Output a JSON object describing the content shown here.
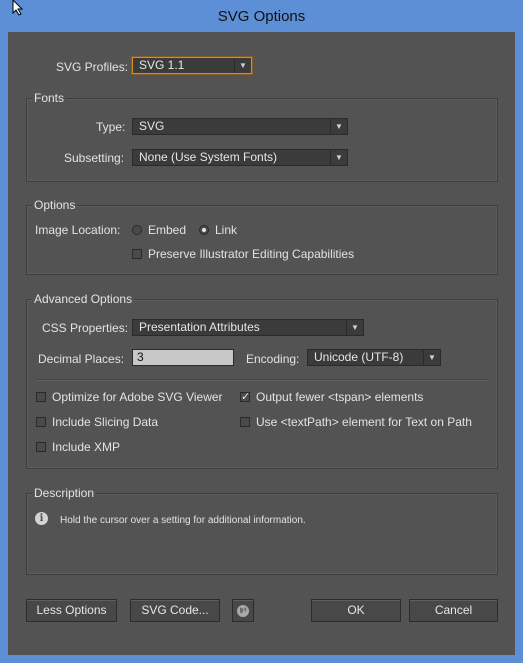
{
  "window": {
    "title": "SVG Options"
  },
  "profiles": {
    "label": "SVG Profiles:",
    "value": "SVG 1.1"
  },
  "fonts": {
    "title": "Fonts",
    "type_label": "Type:",
    "type_value": "SVG",
    "subsetting_label": "Subsetting:",
    "subsetting_value": "None (Use System Fonts)"
  },
  "options": {
    "title": "Options",
    "image_location_label": "Image Location:",
    "embed_label": "Embed",
    "link_label": "Link",
    "selected": "Link",
    "preserve_label": "Preserve Illustrator Editing Capabilities",
    "preserve_checked": false
  },
  "advanced": {
    "title": "Advanced Options",
    "css_label": "CSS Properties:",
    "css_value": "Presentation Attributes",
    "decimal_label": "Decimal Places:",
    "decimal_value": "3",
    "encoding_label": "Encoding:",
    "encoding_value": "Unicode (UTF-8)",
    "checkboxes": {
      "optimize": {
        "label": "Optimize for Adobe SVG Viewer",
        "checked": false
      },
      "tspan": {
        "label": "Output fewer <tspan> elements",
        "checked": true
      },
      "slicing": {
        "label": "Include Slicing Data",
        "checked": false
      },
      "textpath": {
        "label": "Use <textPath> element for Text on Path",
        "checked": false
      },
      "xmp": {
        "label": "Include XMP",
        "checked": false
      }
    }
  },
  "description": {
    "title": "Description",
    "icon": "info-icon",
    "text": "Hold the cursor over a setting for additional information."
  },
  "buttons": {
    "less_options": "Less Options",
    "svg_code": "SVG Code...",
    "web_icon": "globe-icon",
    "ok": "OK",
    "cancel": "Cancel"
  },
  "colors": {
    "titlebar": "#5c8fd6",
    "panel": "#535353",
    "focus": "#e08a22"
  }
}
